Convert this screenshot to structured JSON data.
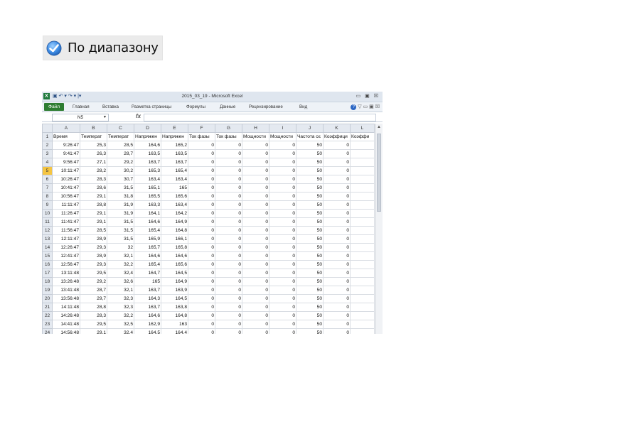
{
  "range_option": {
    "label": "По диапазону"
  },
  "excel": {
    "title": "2015_03_19  -  Microsoft Excel",
    "quick_access": "▣ ↶ ▾ ↷ ▾ |▾",
    "window_buttons": "▭ ▣ ☒",
    "ribbon": {
      "file": "Файл",
      "tabs": [
        "Главная",
        "Вставка",
        "Разметка страницы",
        "Формулы",
        "Данные",
        "Рецензирование",
        "Вид"
      ],
      "right": "▽  ▭ ▣ ☒"
    },
    "name_box": "N5",
    "fx": "fx",
    "columns": [
      "",
      "A",
      "B",
      "C",
      "D",
      "E",
      "F",
      "G",
      "H",
      "I",
      "J",
      "K",
      "L"
    ],
    "header_row": [
      "Время",
      "Температ",
      "Температ",
      "Напряжен",
      "Напряжен",
      "Ток фазы",
      "Ток фазы",
      "Мощности",
      "Мощности",
      "Частота сє",
      "Коэффици",
      "Коэффи"
    ],
    "rows": [
      [
        "9:26:47",
        "25,3",
        "28,5",
        "164,6",
        "165,2",
        "0",
        "0",
        "0",
        "0",
        "50",
        "0",
        ""
      ],
      [
        "9:41:47",
        "26,3",
        "28,7",
        "163,5",
        "163,5",
        "0",
        "0",
        "0",
        "0",
        "50",
        "0",
        ""
      ],
      [
        "9:56:47",
        "27,1",
        "29,2",
        "163,7",
        "163,7",
        "0",
        "0",
        "0",
        "0",
        "50",
        "0",
        ""
      ],
      [
        "10:11:47",
        "28,2",
        "30,2",
        "165,3",
        "165,4",
        "0",
        "0",
        "0",
        "0",
        "50",
        "0",
        ""
      ],
      [
        "10:26:47",
        "28,3",
        "30,7",
        "163,4",
        "163,4",
        "0",
        "0",
        "0",
        "0",
        "50",
        "0",
        ""
      ],
      [
        "10:41:47",
        "28,6",
        "31,5",
        "165,1",
        "165",
        "0",
        "0",
        "0",
        "0",
        "50",
        "0",
        ""
      ],
      [
        "10:56:47",
        "29,1",
        "31,8",
        "165,5",
        "165,6",
        "0",
        "0",
        "0",
        "0",
        "50",
        "0",
        ""
      ],
      [
        "11:11:47",
        "28,8",
        "31,9",
        "163,3",
        "163,4",
        "0",
        "0",
        "0",
        "0",
        "50",
        "0",
        ""
      ],
      [
        "11:26:47",
        "29,1",
        "31,9",
        "164,1",
        "164,2",
        "0",
        "0",
        "0",
        "0",
        "50",
        "0",
        ""
      ],
      [
        "11:41:47",
        "29,1",
        "31,5",
        "164,6",
        "164,9",
        "0",
        "0",
        "0",
        "0",
        "50",
        "0",
        ""
      ],
      [
        "11:56:47",
        "28,5",
        "31,5",
        "165,4",
        "164,8",
        "0",
        "0",
        "0",
        "0",
        "50",
        "0",
        ""
      ],
      [
        "12:11:47",
        "28,9",
        "31,5",
        "165,9",
        "166,1",
        "0",
        "0",
        "0",
        "0",
        "50",
        "0",
        ""
      ],
      [
        "12:26:47",
        "29,3",
        "32",
        "165,7",
        "165,8",
        "0",
        "0",
        "0",
        "0",
        "50",
        "0",
        ""
      ],
      [
        "12:41:47",
        "28,9",
        "32,1",
        "164,6",
        "164,6",
        "0",
        "0",
        "0",
        "0",
        "50",
        "0",
        ""
      ],
      [
        "12:56:47",
        "29,3",
        "32,2",
        "165,4",
        "165,6",
        "0",
        "0",
        "0",
        "0",
        "50",
        "0",
        ""
      ],
      [
        "13:11:48",
        "29,5",
        "32,4",
        "164,7",
        "164,5",
        "0",
        "0",
        "0",
        "0",
        "50",
        "0",
        ""
      ],
      [
        "13:26:48",
        "29,2",
        "32,6",
        "165",
        "164,9",
        "0",
        "0",
        "0",
        "0",
        "50",
        "0",
        ""
      ],
      [
        "13:41:48",
        "28,7",
        "32,1",
        "163,7",
        "163,9",
        "0",
        "0",
        "0",
        "0",
        "50",
        "0",
        ""
      ],
      [
        "13:56:48",
        "29,7",
        "32,3",
        "164,3",
        "164,5",
        "0",
        "0",
        "0",
        "0",
        "50",
        "0",
        ""
      ],
      [
        "14:11:48",
        "28,8",
        "32,3",
        "163,7",
        "163,8",
        "0",
        "0",
        "0",
        "0",
        "50",
        "0",
        ""
      ],
      [
        "14:26:48",
        "28,3",
        "32,2",
        "164,6",
        "164,8",
        "0",
        "0",
        "0",
        "0",
        "50",
        "0",
        ""
      ],
      [
        "14:41:48",
        "29,5",
        "32,5",
        "162,9",
        "163",
        "0",
        "0",
        "0",
        "0",
        "50",
        "0",
        ""
      ],
      [
        "14:56:48",
        "29,1",
        "32,4",
        "164,5",
        "164,4",
        "0",
        "0",
        "0",
        "0",
        "50",
        "0",
        ""
      ]
    ],
    "selected_row": 5,
    "colors": {
      "file_tab": "#2e7d32",
      "selected_row_header": "#f5c542"
    }
  }
}
